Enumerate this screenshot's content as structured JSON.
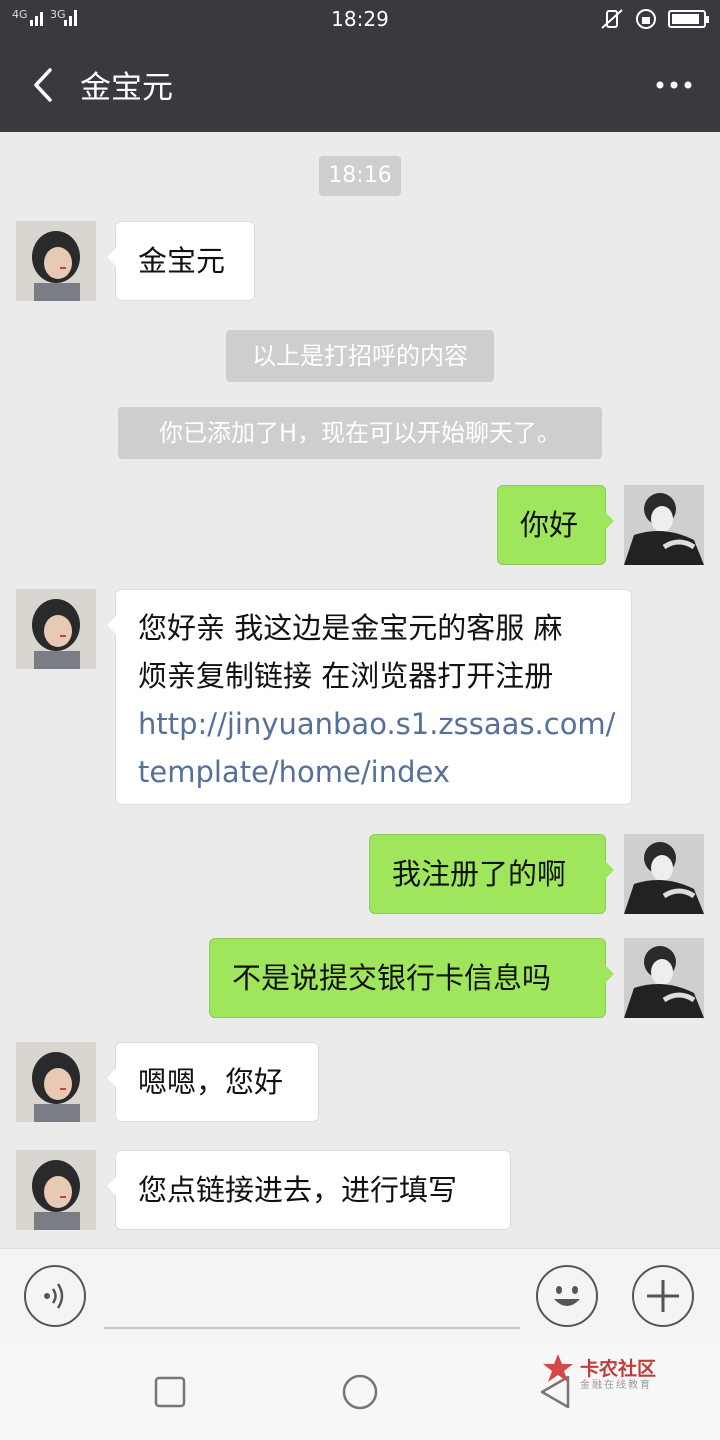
{
  "status": {
    "signal_left_1": "4G",
    "signal_left_2": "3G",
    "time": "18:29",
    "battery_level": 0.9
  },
  "header": {
    "title": "金宝元",
    "back_icon": "chevron-left-icon",
    "more_icon": "more-dots-icon"
  },
  "chat": {
    "timestamp": "18:16",
    "system_1": "以上是打招呼的内容",
    "system_2": "你已添加了H，现在可以开始聊天了。",
    "messages": [
      {
        "from": "contact",
        "text": "金宝元"
      },
      {
        "from": "self",
        "text": "你好"
      },
      {
        "from": "contact",
        "line1": "您好亲 我这边是金宝元的客服 麻",
        "line2": "烦亲复制链接  在浏览器打开注册",
        "link1": "http://jinyuanbao.s1.zssaas.com/",
        "link2": "template/home/index"
      },
      {
        "from": "self",
        "text": "我注册了的啊"
      },
      {
        "from": "self",
        "text": "不是说提交银行卡信息吗"
      },
      {
        "from": "contact",
        "text": "嗯嗯，您好"
      },
      {
        "from": "contact",
        "text": "您点链接进去，进行填写"
      }
    ]
  },
  "input": {
    "voice_icon": "voice-icon",
    "emoji_icon": "emoji-icon",
    "plus_icon": "plus-icon"
  },
  "nav": {
    "recents_icon": "square-icon",
    "home_icon": "circle-icon",
    "back_icon": "triangle-back-icon"
  },
  "watermark": {
    "title": "卡农社区",
    "subtitle": "金融在线教育"
  },
  "colors": {
    "header_bg": "#393a3f",
    "chat_bg": "#ebebeb",
    "self_bubble": "#9fe65c",
    "link": "#56709a"
  }
}
